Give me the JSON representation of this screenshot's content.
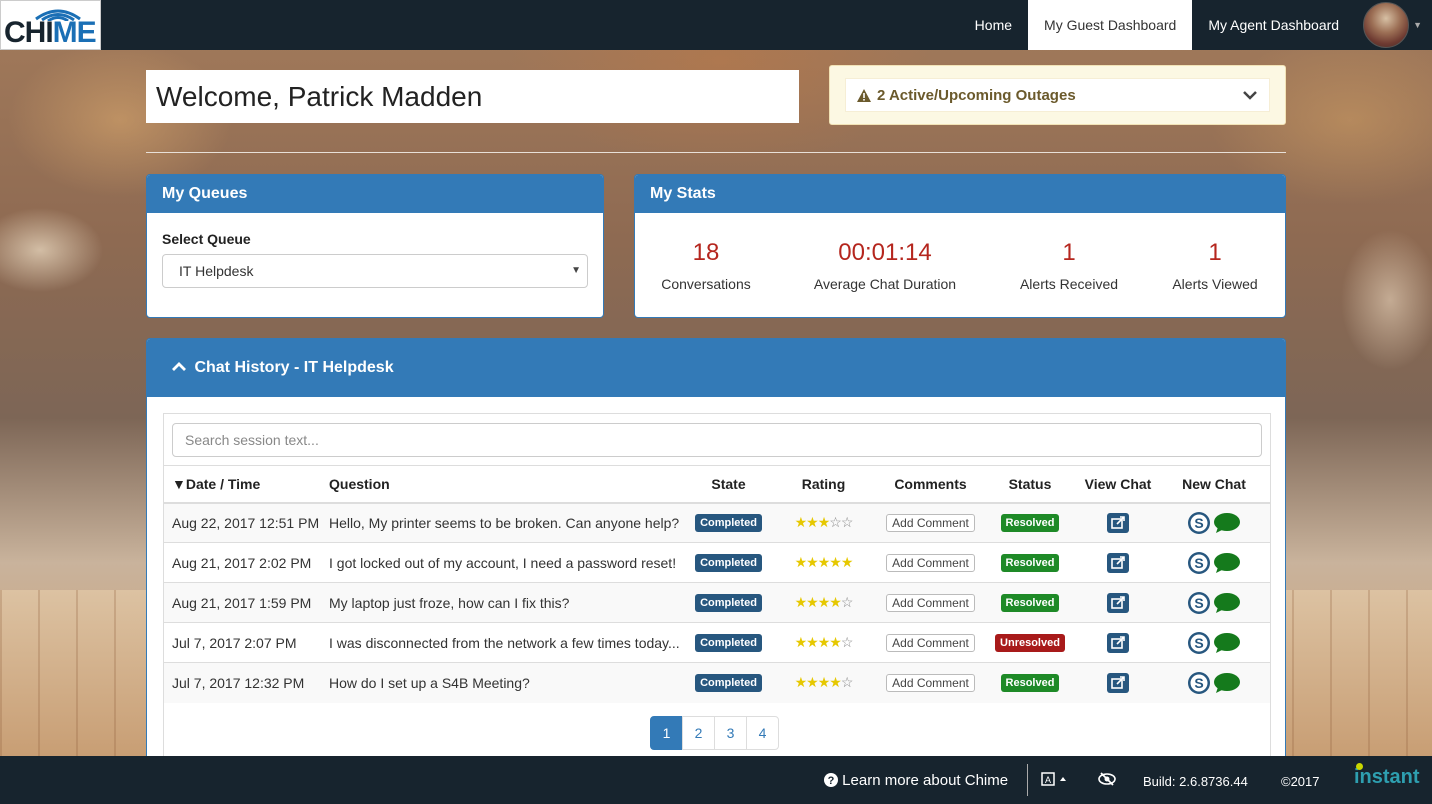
{
  "brand": {
    "logo_text_a": "CHI",
    "logo_text_b": "ME"
  },
  "nav": {
    "items": [
      {
        "label": "Home",
        "active": false
      },
      {
        "label": "My Guest Dashboard",
        "active": true
      },
      {
        "label": "My Agent Dashboard",
        "active": false
      }
    ]
  },
  "welcome": {
    "title": "Welcome, Patrick Madden"
  },
  "outage": {
    "label": "2 Active/Upcoming Outages"
  },
  "queues": {
    "title": "My Queues",
    "select_label": "Select Queue",
    "selected": "IT Helpdesk"
  },
  "stats": {
    "title": "My Stats",
    "items": [
      {
        "value": "18",
        "label": "Conversations"
      },
      {
        "value": "00:01:14",
        "label": "Average Chat Duration"
      },
      {
        "value": "1",
        "label": "Alerts Received"
      },
      {
        "value": "1",
        "label": "Alerts Viewed"
      }
    ]
  },
  "history": {
    "title": "Chat History - IT Helpdesk",
    "search_placeholder": "Search session text...",
    "columns": [
      "Date / Time",
      "Question",
      "State",
      "Rating",
      "Comments",
      "Status",
      "View Chat",
      "New Chat"
    ],
    "sort_indicator": "▼",
    "comment_label": "Add Comment",
    "rows": [
      {
        "date": "Aug 22, 2017 12:51 PM",
        "question": "Hello, My printer seems to be broken. Can anyone help?",
        "state": "Completed",
        "rating": 3,
        "status": "Resolved"
      },
      {
        "date": "Aug 21, 2017 2:02 PM",
        "question": "I got locked out of my account, I need a password reset!",
        "state": "Completed",
        "rating": 5,
        "status": "Resolved"
      },
      {
        "date": "Aug 21, 2017 1:59 PM",
        "question": "My laptop just froze, how can I fix this?",
        "state": "Completed",
        "rating": 4,
        "status": "Resolved"
      },
      {
        "date": "Jul 7, 2017 2:07 PM",
        "question": "I was disconnected from the network a few times today...",
        "state": "Completed",
        "rating": 4,
        "status": "Unresolved"
      },
      {
        "date": "Jul 7, 2017 12:32 PM",
        "question": "How do I set up a S4B Meeting?",
        "state": "Completed",
        "rating": 4,
        "status": "Resolved"
      }
    ],
    "pages": [
      "1",
      "2",
      "3",
      "4"
    ],
    "current_page": "1"
  },
  "footer": {
    "learn": "Learn more about Chime",
    "build": "Build: 2.6.8736.44",
    "copyright": "©2017",
    "instant": "instant"
  },
  "colors": {
    "primary": "#337ab7",
    "nav_bg": "#17242e",
    "stat_value": "#b5261e",
    "resolved": "#1e8a27",
    "unresolved": "#a81a1a",
    "state_badge": "#27577f"
  }
}
